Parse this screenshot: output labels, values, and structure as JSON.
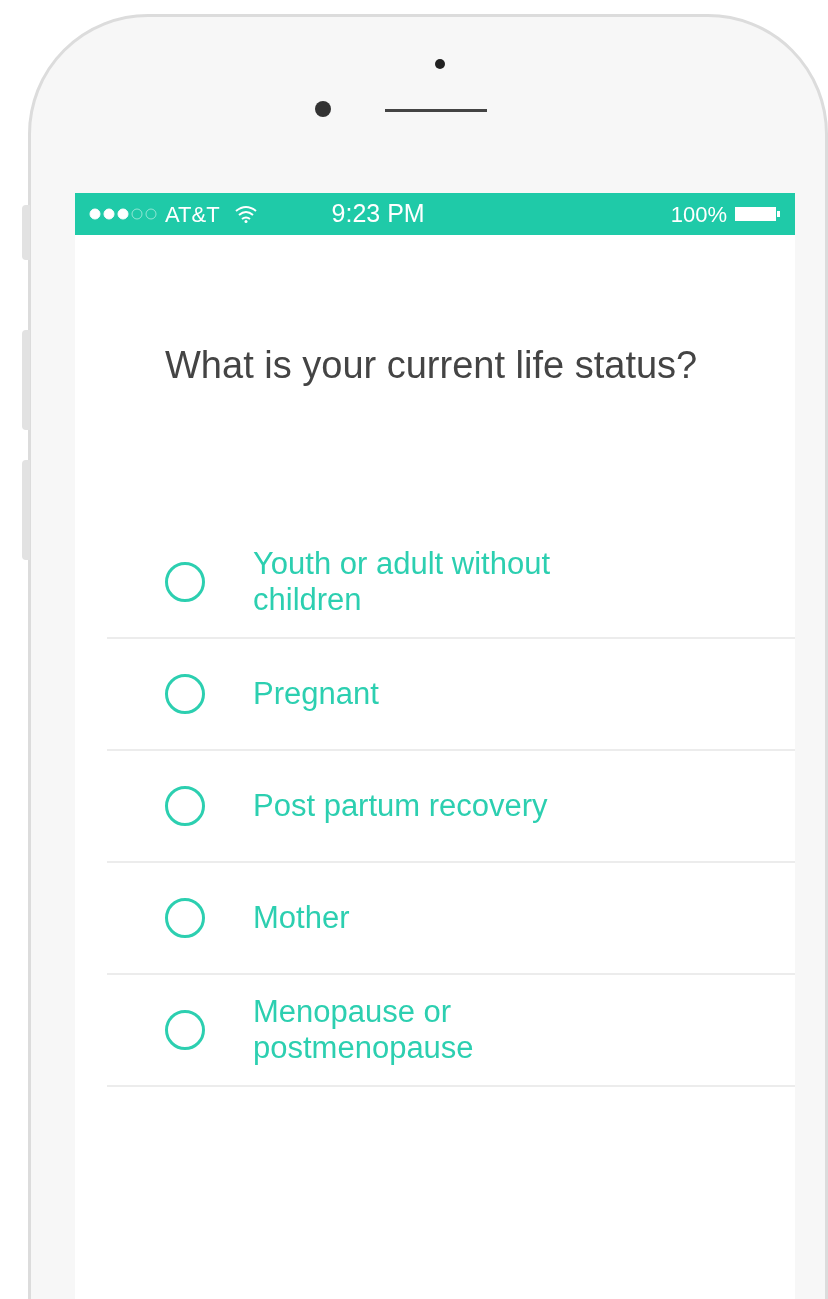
{
  "status_bar": {
    "carrier": "AT&T",
    "time": "9:23 PM",
    "battery": "100%"
  },
  "question": "What is your current life status?",
  "options": [
    {
      "label": "Youth or adult without children",
      "selected": false
    },
    {
      "label": "Pregnant",
      "selected": false
    },
    {
      "label": "Post partum recovery",
      "selected": false
    },
    {
      "label": "Mother",
      "selected": false
    },
    {
      "label": "Menopause or postmenopause",
      "selected": false
    }
  ]
}
